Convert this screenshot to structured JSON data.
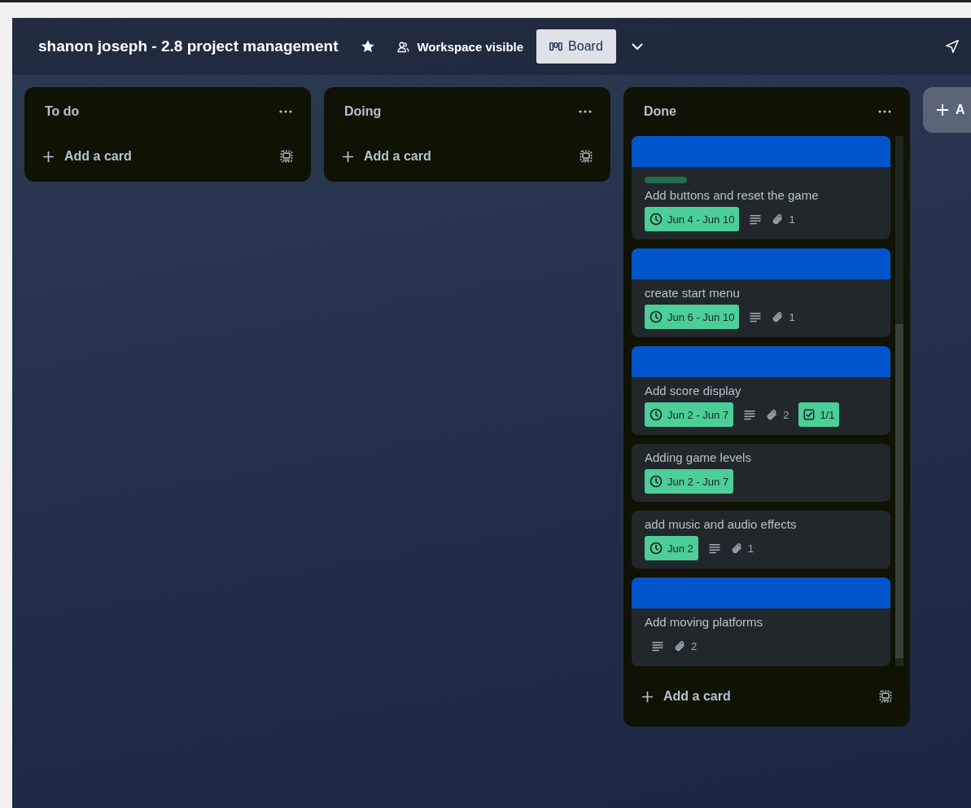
{
  "board": {
    "title": "shanon joseph - 2.8 project management",
    "starred": true,
    "visibility": "Workspace visible",
    "views": [
      {
        "label": "Board",
        "selected": true
      }
    ]
  },
  "lists": [
    {
      "name": "To do",
      "add_label": "Add a card"
    },
    {
      "name": "Doing",
      "add_label": "Add a card"
    },
    {
      "name": "Done",
      "add_label": "Add a card",
      "cards": [
        {
          "cover": true,
          "labels": [
            {
              "color": "#216e4e"
            }
          ],
          "title": "Add buttons and reset the game",
          "badges": [
            {
              "kind": "date",
              "text": "Jun 4 - Jun 10",
              "complete": true
            },
            {
              "kind": "description"
            },
            {
              "kind": "attachments",
              "text": "1"
            }
          ]
        },
        {
          "cover": true,
          "title": "create start menu",
          "badges": [
            {
              "kind": "date",
              "text": "Jun 6 - Jun 10",
              "complete": true
            },
            {
              "kind": "description"
            },
            {
              "kind": "attachments",
              "text": "1"
            }
          ]
        },
        {
          "cover": true,
          "title": "Add score display",
          "badges": [
            {
              "kind": "date",
              "text": "Jun 2 - Jun 7",
              "complete": true
            },
            {
              "kind": "description"
            },
            {
              "kind": "attachments",
              "text": "2"
            },
            {
              "kind": "checklist",
              "text": "1/1",
              "complete": true
            }
          ]
        },
        {
          "cover": false,
          "title": "Adding game levels",
          "badges": [
            {
              "kind": "date",
              "text": "Jun 2 - Jun 7",
              "complete": true
            }
          ]
        },
        {
          "cover": false,
          "title": "add music and audio effects",
          "badges": [
            {
              "kind": "date",
              "text": "Jun 2",
              "complete": true
            },
            {
              "kind": "description"
            },
            {
              "kind": "attachments",
              "text": "1"
            }
          ]
        },
        {
          "cover": true,
          "title": "Add moving platforms",
          "badges": [
            {
              "kind": "description"
            },
            {
              "kind": "attachments",
              "text": "2"
            }
          ]
        }
      ]
    }
  ],
  "add_list": {
    "label": "A"
  }
}
